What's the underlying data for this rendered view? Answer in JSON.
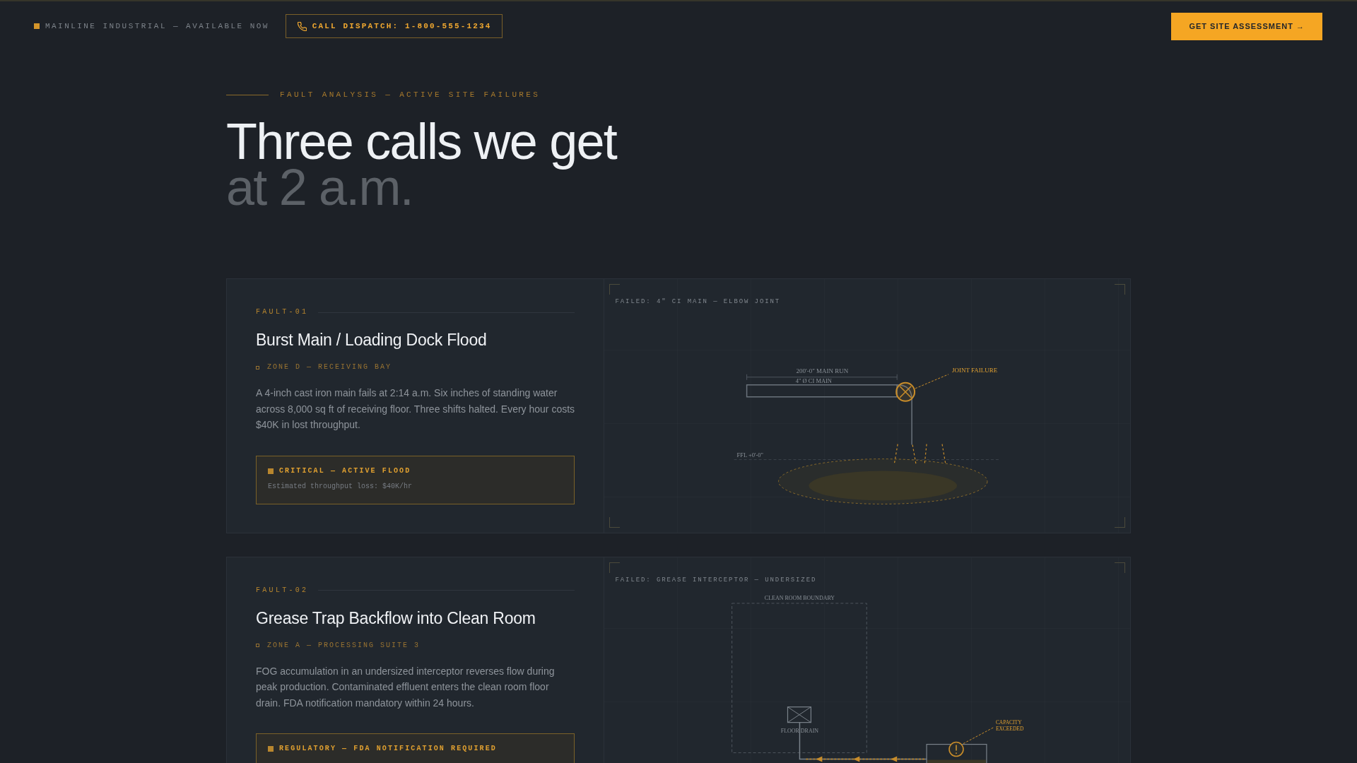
{
  "topbar": {
    "status": "MAINLINE INDUSTRIAL — AVAILABLE NOW",
    "dispatch_button": "CALL DISPATCH: 1-800-555-1234",
    "cta_button": "GET SITE ASSESSMENT →"
  },
  "section": {
    "eyebrow": "FAULT ANALYSIS — ACTIVE SITE FAILURES",
    "heading": [
      "Three calls we get",
      "at 2 a.m."
    ]
  },
  "faults": [
    {
      "code": "FAULT-01",
      "title": "Burst Main / Loading Dock Flood",
      "zone": "ZONE D — RECEIVING BAY",
      "description": "A 4-inch cast iron main fails at 2:14 a.m. Six inches of standing water across 8,000 sq ft of receiving floor. Three shifts halted. Every hour costs $40K in lost throughput.",
      "alert": {
        "title": "CRITICAL — ACTIVE FLOOD",
        "detail": "Estimated throughput loss: $40K/hr"
      },
      "diagram": {
        "kind": "pipe_burst",
        "caption": "FAILED: 4\" CI MAIN — ELBOW JOINT",
        "dimension_label": "200'-0\" MAIN RUN",
        "pipe_label": "4\" Ø CI MAIN",
        "failure_label": "JOINT FAILURE",
        "floor_label": "FFL +0'-0\""
      }
    },
    {
      "code": "FAULT-02",
      "title": "Grease Trap Backflow into Clean Room",
      "zone": "ZONE A — PROCESSING SUITE 3",
      "description": "FOG accumulation in an undersized interceptor reverses flow during peak production. Contaminated effluent enters the clean room floor drain. FDA notification mandatory within 24 hours.",
      "alert": {
        "title": "REGULATORY — FDA NOTIFICATION REQUIRED"
      },
      "diagram": {
        "kind": "grease_interceptor",
        "caption": "FAILED: GREASE INTERCEPTOR — UNDERSIZED",
        "boundary_label": "CLEAN ROOM BOUNDARY",
        "drain_label": "FLOOR DRAIN",
        "failure_label": "CAPACITY EXCEEDED"
      }
    }
  ]
}
